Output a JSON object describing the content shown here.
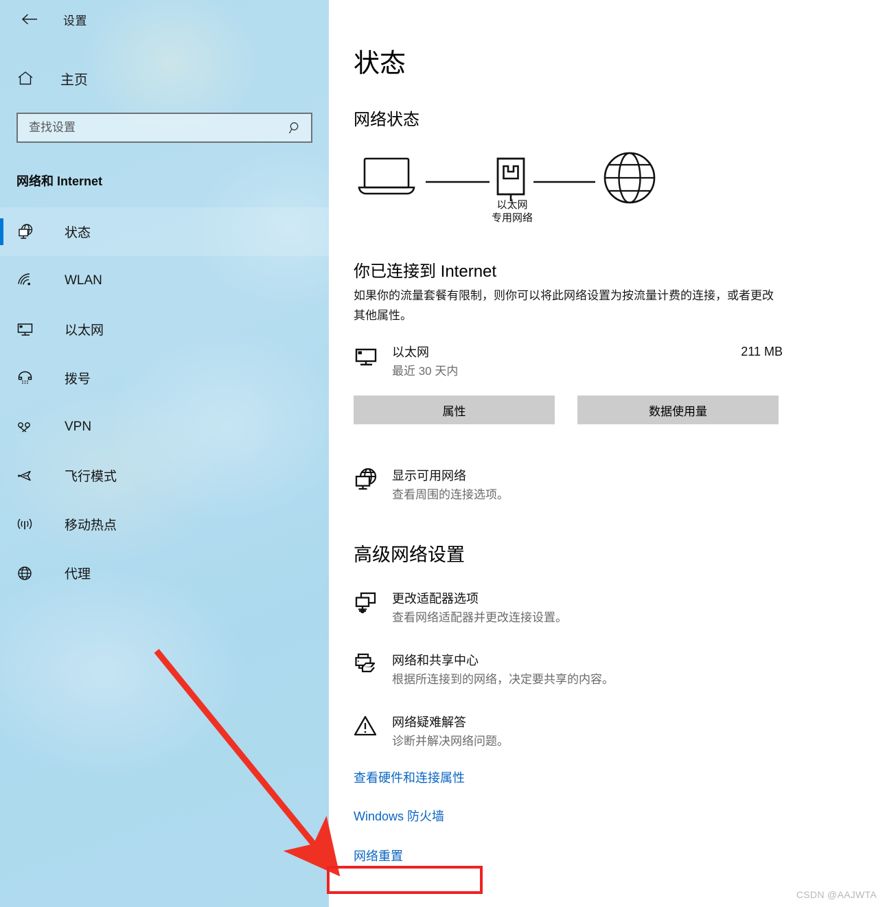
{
  "window": {
    "back_label": "←",
    "title": "设置"
  },
  "sidebar": {
    "home_label": "主页",
    "search": {
      "placeholder": "查找设置",
      "value": ""
    },
    "category_title": "网络和 Internet",
    "items": [
      {
        "label": "状态",
        "icon": "globe-monitor-icon",
        "selected": true
      },
      {
        "label": "WLAN",
        "icon": "wifi-icon",
        "selected": false
      },
      {
        "label": "以太网",
        "icon": "ethernet-icon",
        "selected": false
      },
      {
        "label": "拨号",
        "icon": "dialup-icon",
        "selected": false
      },
      {
        "label": "VPN",
        "icon": "vpn-icon",
        "selected": false
      },
      {
        "label": "飞行模式",
        "icon": "airplane-icon",
        "selected": false
      },
      {
        "label": "移动热点",
        "icon": "hotspot-icon",
        "selected": false
      },
      {
        "label": "代理",
        "icon": "proxy-globe-icon",
        "selected": false
      }
    ]
  },
  "main": {
    "page_title": "状态",
    "network_status_heading": "网络状态",
    "diagram": {
      "device_icon": "laptop-icon",
      "node_icon": "ethernet-port-icon",
      "internet_icon": "globe-icon",
      "node_label_line1": "以太网",
      "node_label_line2": "专用网络"
    },
    "connected_heading": "你已连接到 Internet",
    "connected_body": "如果你的流量套餐有限制，则你可以将此网络设置为按流量计费的连接，或者更改其他属性。",
    "connection": {
      "icon": "monitor-icon",
      "name": "以太网",
      "period": "最近 30 天内",
      "usage": "211 MB"
    },
    "buttons": {
      "properties": "属性",
      "data_usage": "数据使用量"
    },
    "show_networks": {
      "icon": "globe-monitor-icon",
      "title": "显示可用网络",
      "subtitle": "查看周围的连接选项。"
    },
    "advanced_heading": "高级网络设置",
    "advanced_items": [
      {
        "icon": "adapter-monitor-icon",
        "title": "更改适配器选项",
        "subtitle": "查看网络适配器并更改连接设置。"
      },
      {
        "icon": "printer-folder-icon",
        "title": "网络和共享中心",
        "subtitle": "根据所连接到的网络，决定要共享的内容。"
      },
      {
        "icon": "warning-triangle-icon",
        "title": "网络疑难解答",
        "subtitle": "诊断并解决网络问题。"
      }
    ],
    "links": [
      {
        "label": "查看硬件和连接属性"
      },
      {
        "label": "Windows 防火墙"
      }
    ],
    "highlighted_link": {
      "label": "网络重置"
    }
  },
  "annotations": {
    "arrow_color": "#ef3124",
    "highlight_box_color": "#f02222",
    "watermark": "CSDN @AAJWTA"
  },
  "colors": {
    "accent": "#0078d7",
    "link": "#0a66c2",
    "sidebar_bg": "#b3dcef",
    "button_bg": "#cccccc"
  }
}
